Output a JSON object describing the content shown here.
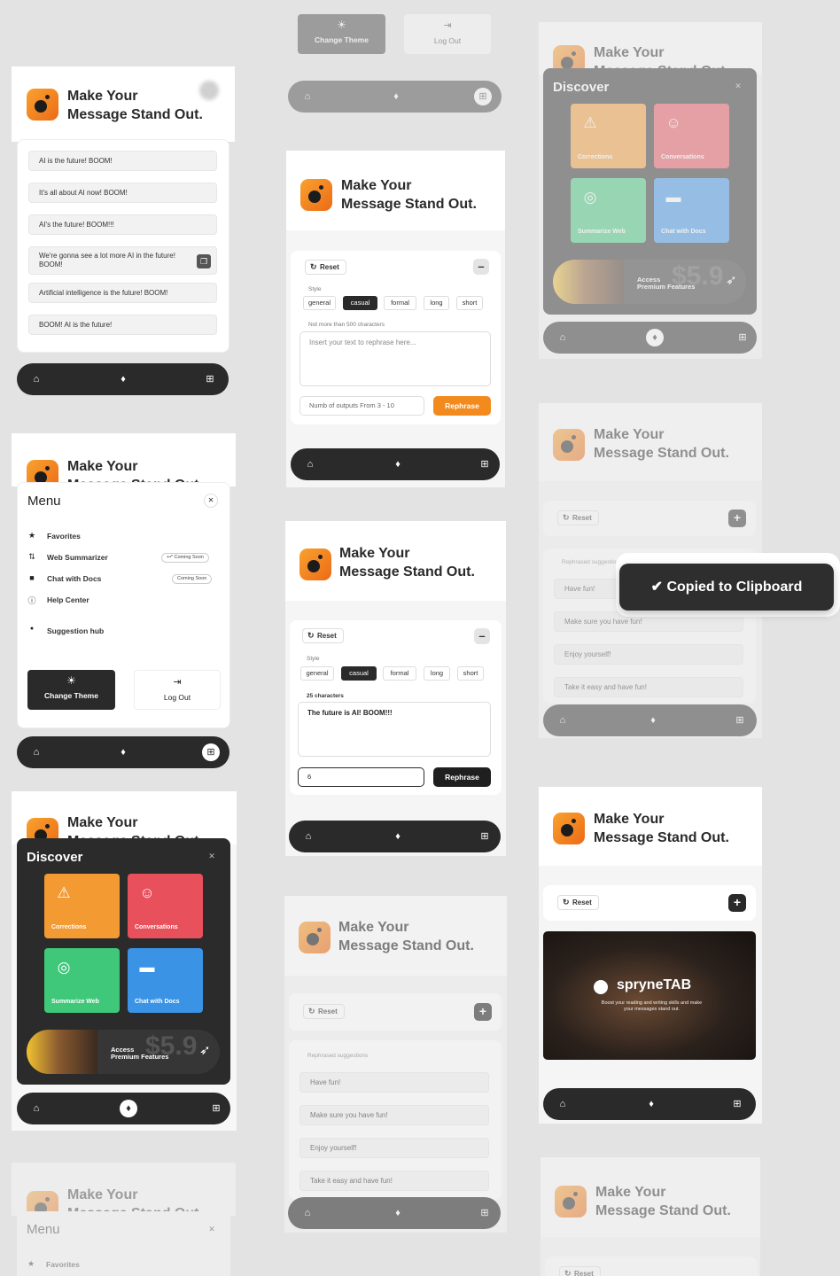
{
  "app": {
    "title": "Make Your\nMessage Stand Out."
  },
  "nav": {
    "home": "⌂",
    "diamond": "♦",
    "grid": "⊞"
  },
  "outputs": {
    "items": [
      "AI is the future! BOOM!",
      "It's all about AI now! BOOM!",
      "AI's the future! BOOM!!!",
      "We're gonna see a lot more AI in the future! BOOM!",
      "Artificial intelligence is the future! BOOM!",
      "BOOM! AI is the future!"
    ]
  },
  "menu": {
    "title": "Menu",
    "close": "✕",
    "items": [
      {
        "label": "Favorites",
        "icon": "★",
        "badge": ""
      },
      {
        "label": "Web Summarizer",
        "icon": "⇅",
        "badge": "+•˟ Coming Soon"
      },
      {
        "label": "Chat with Docs",
        "icon": "■",
        "badge": "Coming Soon"
      },
      {
        "label": "Help Center",
        "icon": "ⓘ",
        "badge": ""
      },
      {
        "label": "Suggestion hub",
        "icon": "●",
        "badge": ""
      }
    ],
    "change_theme": "Change Theme",
    "logout": "Log Out",
    "theme_icon": "☀",
    "logout_icon": "⇥"
  },
  "discover": {
    "title": "Discover",
    "close": "✕",
    "tiles": [
      {
        "label": "Corrections",
        "icon": "⚠",
        "color": "#f39a32"
      },
      {
        "label": "Conversations",
        "icon": "☺",
        "color": "#e8505c"
      },
      {
        "label": "Summarize Web",
        "icon": "◎",
        "color": "#3fc87a"
      },
      {
        "label": "Chat with Docs",
        "icon": "▬",
        "color": "#3b93e6"
      }
    ],
    "premium_price": "$5.9",
    "premium_line1": "Access",
    "premium_line2": "Premium Features",
    "rocket": "➶"
  },
  "rephrase": {
    "reset": "Reset",
    "minus": "–",
    "plus": "+",
    "style_label": "Style",
    "styles": [
      "general",
      "casual",
      "formal",
      "long",
      "short"
    ],
    "selected_style": "casual",
    "char_hint": "Not more than 500 characters",
    "placeholder": "Insert your text to rephrase here...",
    "outputs_placeholder": "Numb of outputs From 3 - 10",
    "button": "Rephrase",
    "filled_count": "25 characters",
    "filled_text": "The future is AI! BOOM!!!",
    "filled_outputs": "6"
  },
  "suggestions": {
    "label": "Rephrased suggestions",
    "items": [
      "Have fun!",
      "Make sure you have fun!",
      "Enjoy yourself!",
      "Take it easy and have fun!"
    ]
  },
  "toast": {
    "text": "✔ Copied to Clipboard"
  },
  "promo": {
    "brand": "spryneTAB",
    "tagline": "Boost your reading and writing skills and make your messages stand out."
  },
  "colors": {
    "accent": "#f28a1e",
    "dark": "#2a2a2a",
    "bg": "#e3e3e3"
  }
}
